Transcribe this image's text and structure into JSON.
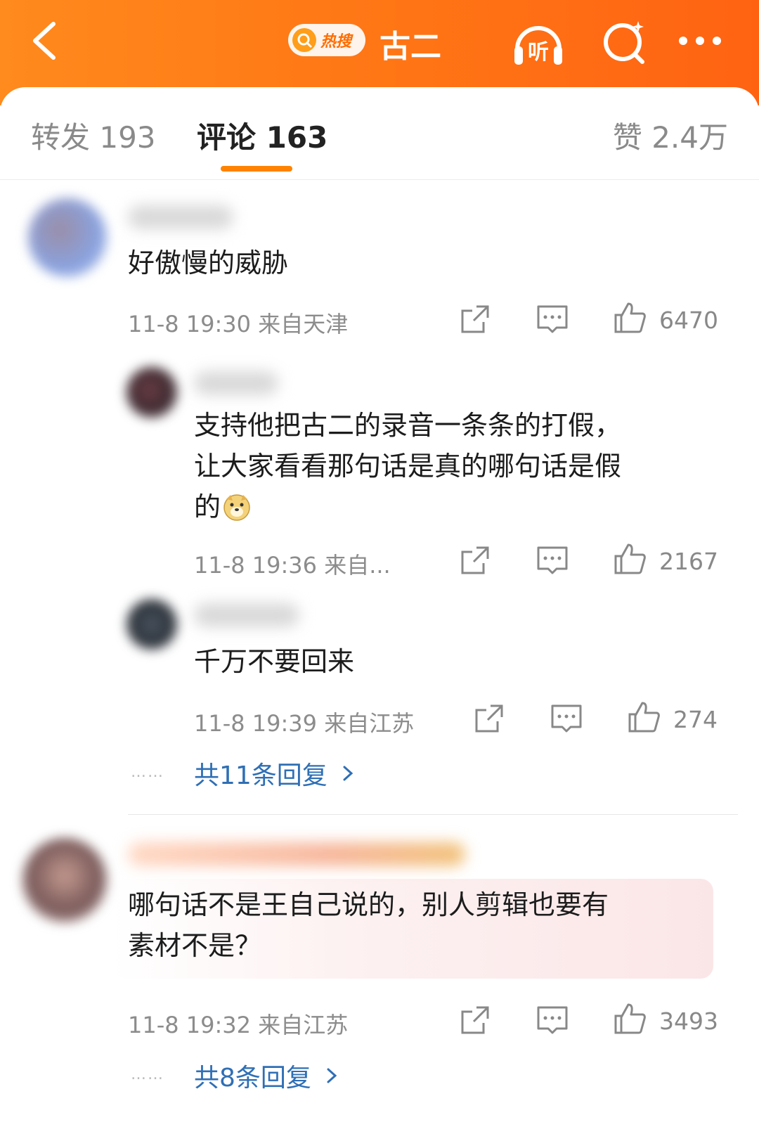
{
  "header": {
    "hot_badge_label": "热搜",
    "topic_title": "古二",
    "listen_label": "听",
    "accent_color": "#ff7a16"
  },
  "tabs": {
    "repost": "转发 193",
    "comments": "评论 163",
    "likes": "赞 2.4万"
  },
  "comments": [
    {
      "text": "好傲慢的威胁",
      "meta": "11-8 19:30  来自天津",
      "likes": "6470",
      "replies": [
        {
          "text_lines": [
            "支持他把古二的录音一条条的打假，",
            "让大家看看那句话是真的哪句话是假",
            "的"
          ],
          "emoji": "doge",
          "meta": "11-8 19:36  来自...",
          "likes": "2167"
        },
        {
          "text": "千万不要回来",
          "meta": "11-8 19:39  来自江苏",
          "likes": "274"
        }
      ],
      "reply_link": "共11条回复",
      "reply_dots": "……"
    },
    {
      "text_lines": [
        "哪句话不是王自己说的，别人剪辑也要有",
        "素材不是？"
      ],
      "meta": "11-8 19:32  来自江苏",
      "likes": "3493",
      "reply_link": "共8条回复",
      "reply_dots": "……"
    }
  ]
}
